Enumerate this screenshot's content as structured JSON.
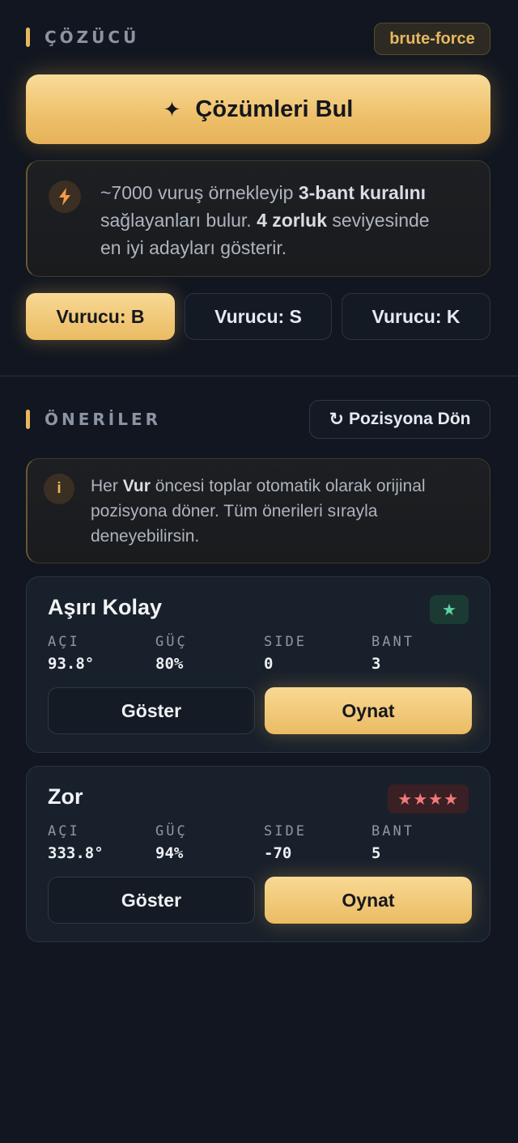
{
  "solver": {
    "title": "ÇÖZÜCÜ",
    "badge": "brute-force",
    "find_button": "Çözümleri Bul",
    "find_icon": "sparkle-icon",
    "info": {
      "icon": "lightning-icon",
      "t1": "~7000 vuruş örnekleyip ",
      "b1": "3-bant kuralını",
      "t2": "sağlayanları bulur. ",
      "b2": "4 zorluk",
      "t3": " seviyesinde",
      "t4": "en iyi adayları gösterir."
    },
    "hitters": [
      {
        "label": "Vurucu: B",
        "selected": true
      },
      {
        "label": "Vurucu: S",
        "selected": false
      },
      {
        "label": "Vurucu: K",
        "selected": false
      }
    ]
  },
  "suggestions": {
    "title": "ÖNERİLER",
    "reset_button": "Pozisyona Dön",
    "reset_icon": "rotate-icon",
    "info": {
      "icon": "info-icon",
      "icon_char": "i",
      "t1": "Her ",
      "b1": "Vur",
      "t2": " öncesi toplar otomatik olarak orijinal",
      "t3": "pozisyona döner. Tüm önerileri sırayla",
      "t4": "deneyebilirsin."
    },
    "stat_labels": {
      "angle": "AÇI",
      "power": "GÜÇ",
      "side": "SIDE",
      "bank": "BANT"
    },
    "cards": [
      {
        "title": "Aşırı Kolay",
        "stars": "★",
        "difficulty_color": "#5fd3a2",
        "angle": "93.8°",
        "power": "80%",
        "side": "0",
        "bank": "3",
        "show": "Göster",
        "play": "Oynat"
      },
      {
        "title": "Zor",
        "stars": "★★★★",
        "difficulty_color": "#f07a7a",
        "angle": "333.8°",
        "power": "94%",
        "side": "-70",
        "bank": "5",
        "show": "Göster",
        "play": "Oynat"
      }
    ]
  },
  "colors": {
    "accent": "#e8b85a",
    "background": "#111620",
    "card": "#18202b"
  }
}
